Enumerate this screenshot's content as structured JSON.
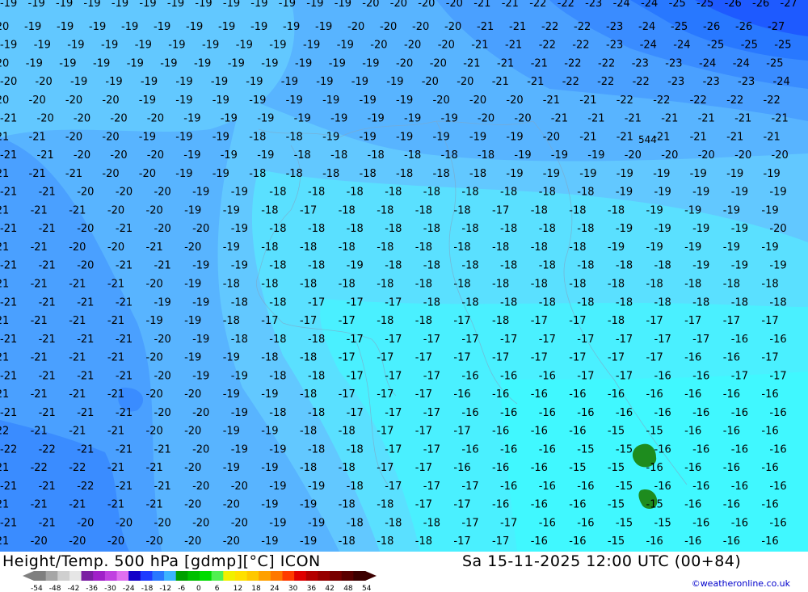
{
  "map": {
    "contour_labels_rows": [
      [
        "19",
        "19",
        "19",
        "19",
        "19",
        "19",
        "19",
        "19",
        "19",
        "19",
        "19",
        "19",
        "19",
        "20",
        "20",
        "20",
        "20",
        "21",
        "21",
        "22",
        "22",
        "23",
        "24",
        "24",
        "25",
        "25",
        "26",
        "26",
        "27"
      ],
      [
        "20",
        "19",
        "19",
        "19",
        "19",
        "19",
        "19",
        "19",
        "19",
        "19",
        "19",
        "20",
        "20",
        "20",
        "20",
        "21",
        "21",
        "22",
        "22",
        "23",
        "24",
        "25",
        "26",
        "26",
        "27"
      ],
      [
        "19",
        "19",
        "19",
        "19",
        "19",
        "19",
        "19",
        "19",
        "19",
        "19",
        "19",
        "20",
        "20",
        "20",
        "21",
        "21",
        "22",
        "22",
        "23",
        "24",
        "24",
        "25",
        "25",
        "25"
      ],
      [
        "20",
        "19",
        "19",
        "19",
        "19",
        "19",
        "19",
        "19",
        "19",
        "19",
        "19",
        "19",
        "20",
        "20",
        "21",
        "21",
        "21",
        "22",
        "22",
        "23",
        "23",
        "24",
        "24",
        "25"
      ],
      [
        "20",
        "20",
        "19",
        "19",
        "19",
        "19",
        "19",
        "19",
        "19",
        "19",
        "19",
        "19",
        "20",
        "20",
        "21",
        "21",
        "22",
        "22",
        "22",
        "23",
        "23",
        "23",
        "24"
      ],
      [
        "20",
        "20",
        "20",
        "20",
        "19",
        "19",
        "19",
        "19",
        "19",
        "19",
        "19",
        "19",
        "20",
        "20",
        "20",
        "21",
        "21",
        "22",
        "22",
        "22",
        "22",
        "22"
      ],
      [
        "21",
        "20",
        "20",
        "20",
        "20",
        "19",
        "19",
        "19",
        "19",
        "19",
        "19",
        "19",
        "19",
        "20",
        "20",
        "21",
        "21",
        "21",
        "21",
        "21",
        "21",
        "21"
      ],
      [
        "21",
        "21",
        "20",
        "20",
        "19",
        "19",
        "19",
        "18",
        "18",
        "19",
        "19",
        "19",
        "19",
        "19",
        "19",
        "20",
        "21",
        "21",
        "21",
        "21",
        "21",
        "21"
      ],
      [
        "21",
        "21",
        "20",
        "20",
        "20",
        "19",
        "19",
        "19",
        "18",
        "18",
        "18",
        "18",
        "18",
        "18",
        "19",
        "19",
        "19",
        "20",
        "20",
        "20",
        "20",
        "20"
      ],
      [
        "21",
        "21",
        "21",
        "20",
        "20",
        "19",
        "19",
        "18",
        "18",
        "18",
        "18",
        "18",
        "18",
        "18",
        "19",
        "19",
        "19",
        "19",
        "19",
        "19",
        "19",
        "19"
      ],
      [
        "21",
        "21",
        "20",
        "20",
        "20",
        "19",
        "19",
        "18",
        "18",
        "18",
        "18",
        "18",
        "18",
        "18",
        "18",
        "18",
        "19",
        "19",
        "19",
        "19",
        "19"
      ],
      [
        "21",
        "21",
        "21",
        "20",
        "20",
        "19",
        "19",
        "18",
        "17",
        "18",
        "18",
        "18",
        "18",
        "17",
        "18",
        "18",
        "18",
        "19",
        "19",
        "19",
        "19"
      ],
      [
        "21",
        "21",
        "20",
        "21",
        "20",
        "20",
        "19",
        "18",
        "18",
        "18",
        "18",
        "18",
        "18",
        "18",
        "18",
        "18",
        "19",
        "19",
        "19",
        "19",
        "20"
      ],
      [
        "21",
        "21",
        "20",
        "20",
        "21",
        "20",
        "19",
        "18",
        "18",
        "18",
        "18",
        "18",
        "18",
        "18",
        "18",
        "18",
        "19",
        "19",
        "19",
        "19",
        "19"
      ],
      [
        "21",
        "21",
        "20",
        "21",
        "21",
        "19",
        "19",
        "18",
        "18",
        "19",
        "18",
        "18",
        "18",
        "18",
        "18",
        "18",
        "18",
        "18",
        "19",
        "19",
        "19"
      ],
      [
        "21",
        "21",
        "21",
        "21",
        "20",
        "19",
        "18",
        "18",
        "18",
        "18",
        "18",
        "18",
        "18",
        "18",
        "18",
        "18",
        "18",
        "18",
        "18",
        "18",
        "18"
      ],
      [
        "21",
        "21",
        "21",
        "21",
        "19",
        "19",
        "18",
        "18",
        "17",
        "17",
        "17",
        "18",
        "18",
        "18",
        "18",
        "18",
        "18",
        "18",
        "18",
        "18",
        "18"
      ],
      [
        "21",
        "21",
        "21",
        "21",
        "19",
        "19",
        "18",
        "17",
        "17",
        "17",
        "18",
        "18",
        "17",
        "18",
        "17",
        "17",
        "18",
        "17",
        "17",
        "17",
        "17"
      ],
      [
        "21",
        "21",
        "21",
        "21",
        "20",
        "19",
        "18",
        "18",
        "18",
        "17",
        "17",
        "17",
        "17",
        "17",
        "17",
        "17",
        "17",
        "17",
        "17",
        "16",
        "16"
      ],
      [
        "21",
        "21",
        "21",
        "21",
        "20",
        "19",
        "19",
        "18",
        "18",
        "17",
        "17",
        "17",
        "17",
        "17",
        "17",
        "17",
        "17",
        "17",
        "16",
        "16",
        "17"
      ],
      [
        "21",
        "21",
        "21",
        "21",
        "20",
        "19",
        "19",
        "18",
        "18",
        "17",
        "17",
        "17",
        "16",
        "16",
        "16",
        "17",
        "17",
        "16",
        "16",
        "17",
        "17"
      ],
      [
        "21",
        "21",
        "21",
        "21",
        "20",
        "20",
        "19",
        "19",
        "18",
        "17",
        "17",
        "17",
        "16",
        "16",
        "16",
        "16",
        "16",
        "16",
        "16",
        "16",
        "16"
      ],
      [
        "21",
        "21",
        "21",
        "21",
        "20",
        "20",
        "19",
        "18",
        "18",
        "17",
        "17",
        "17",
        "16",
        "16",
        "16",
        "16",
        "16",
        "16",
        "16",
        "16",
        "16"
      ],
      [
        "22",
        "21",
        "21",
        "21",
        "20",
        "20",
        "19",
        "19",
        "18",
        "18",
        "17",
        "17",
        "17",
        "16",
        "16",
        "16",
        "15",
        "15",
        "16",
        "16",
        "16"
      ],
      [
        "22",
        "22",
        "21",
        "21",
        "21",
        "20",
        "19",
        "19",
        "18",
        "18",
        "17",
        "17",
        "16",
        "16",
        "16",
        "15",
        "15",
        "16",
        "16",
        "16",
        "16"
      ],
      [
        "21",
        "22",
        "22",
        "21",
        "21",
        "20",
        "19",
        "19",
        "18",
        "18",
        "17",
        "17",
        "16",
        "16",
        "16",
        "15",
        "15",
        "16",
        "16",
        "16",
        "16"
      ],
      [
        "21",
        "21",
        "22",
        "21",
        "21",
        "20",
        "20",
        "19",
        "19",
        "18",
        "17",
        "17",
        "17",
        "16",
        "16",
        "16",
        "15",
        "16",
        "16",
        "16",
        "16"
      ],
      [
        "21",
        "21",
        "21",
        "21",
        "21",
        "20",
        "20",
        "19",
        "19",
        "18",
        "18",
        "17",
        "17",
        "16",
        "16",
        "16",
        "15",
        "15",
        "16",
        "16",
        "16"
      ],
      [
        "21",
        "21",
        "20",
        "20",
        "20",
        "20",
        "20",
        "19",
        "19",
        "18",
        "18",
        "18",
        "17",
        "17",
        "16",
        "16",
        "15",
        "15",
        "16",
        "16",
        "16"
      ],
      [
        "21",
        "20",
        "20",
        "20",
        "20",
        "20",
        "20",
        "19",
        "19",
        "18",
        "18",
        "18",
        "17",
        "17",
        "16",
        "16",
        "15",
        "16",
        "16",
        "16",
        "16"
      ]
    ],
    "pressure_label": "544"
  },
  "footer": {
    "title_left": "Height/Temp. 500 hPa [gdmp][°C] ICON",
    "title_right": "Sa 15-11-2025 12:00 UTC (00+84)",
    "credit": "©weatheronline.co.uk",
    "scale_ticks": [
      "-54",
      "-48",
      "-42",
      "-36",
      "-30",
      "-24",
      "-18",
      "-12",
      "-6",
      "0",
      "6",
      "12",
      "18",
      "24",
      "30",
      "36",
      "42",
      "48",
      "54"
    ],
    "scale_colors": [
      "#7f7f7f",
      "#a6a6a6",
      "#cfcfcf",
      "#e6e6e6",
      "#7b1fa2",
      "#a020c8",
      "#c040e0",
      "#e070f0",
      "#1400c8",
      "#1e3cff",
      "#2878ff",
      "#3cb4ff",
      "#00a000",
      "#00c000",
      "#00dc00",
      "#50f050",
      "#f0f000",
      "#ffe000",
      "#ffc800",
      "#ffa000",
      "#ff7800",
      "#ff3c00",
      "#e00000",
      "#b40000",
      "#960000",
      "#780000",
      "#5a0000",
      "#3c0000"
    ]
  },
  "colors": {
    "band_22": "#3a8cff",
    "band_21": "#4aa0ff",
    "band_20": "#58b4ff",
    "band_19": "#62c8ff",
    "band_18": "#5ae0ff",
    "band_17": "#4af0ff",
    "band_16": "#40f8ff",
    "band_23plus": "#2878ff",
    "band_25plus": "#1e5aff",
    "green_cell": "#1e8c1e",
    "label": "#000000"
  }
}
